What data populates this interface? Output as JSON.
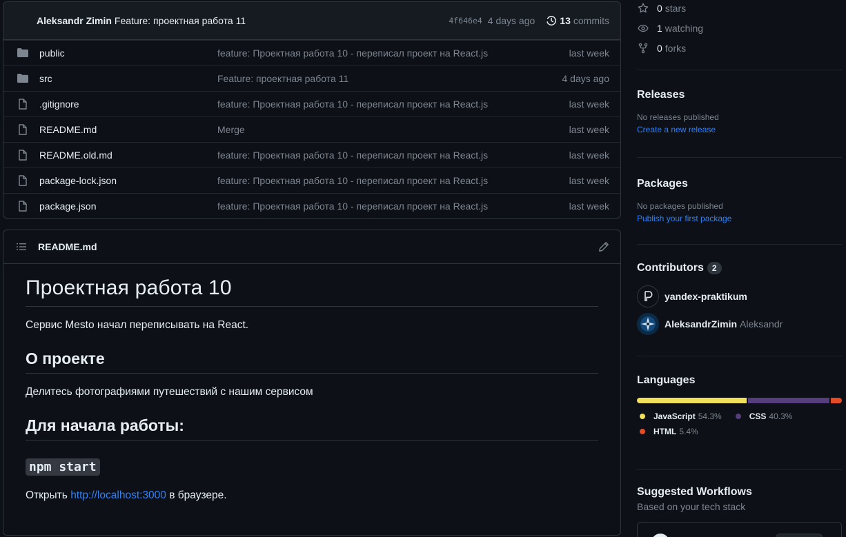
{
  "latest_commit": {
    "author": "Aleksandr Zimin",
    "message": "Feature: проектная работа 11",
    "sha": "4f646e4",
    "when": "4 days ago",
    "commits_count": "13",
    "commits_label": "commits"
  },
  "files": [
    {
      "type": "folder",
      "name": "public",
      "message": "feature: Проектная работа 10 - переписал проект на React.js",
      "when": "last week"
    },
    {
      "type": "folder",
      "name": "src",
      "message": "Feature: проектная работа 11",
      "when": "4 days ago"
    },
    {
      "type": "file",
      "name": ".gitignore",
      "message": "feature: Проектная работа 10 - переписал проект на React.js",
      "when": "last week"
    },
    {
      "type": "file",
      "name": "README.md",
      "message": "Merge",
      "when": "last week"
    },
    {
      "type": "file",
      "name": "README.old.md",
      "message": "feature: Проектная работа 10 - переписал проект на React.js",
      "when": "last week"
    },
    {
      "type": "file",
      "name": "package-lock.json",
      "message": "feature: Проектная работа 10 - переписал проект на React.js",
      "when": "last week"
    },
    {
      "type": "file",
      "name": "package.json",
      "message": "feature: Проектная работа 10 - переписал проект на React.js",
      "when": "last week"
    }
  ],
  "readme": {
    "filename": "README.md",
    "h1": "Проектная работа 10",
    "intro": "Сервис Mesto начал переписывать на React.",
    "h2_about": "О проекте",
    "about_text": "Делитесь фотографиями путешествий с нашим сервисом",
    "h2_start": "Для начала работы:",
    "code": "npm start",
    "open_prefix": "Открыть",
    "open_link": "http://localhost:3000",
    "open_suffix": "в браузере."
  },
  "sidebar": {
    "stars_count": "0",
    "stars_label": "stars",
    "watching_count": "1",
    "watching_label": "watching",
    "forks_count": "0",
    "forks_label": "forks",
    "releases": {
      "title": "Releases",
      "empty": "No releases published",
      "link": "Create a new release"
    },
    "packages": {
      "title": "Packages",
      "empty": "No packages published",
      "link": "Publish your first package"
    },
    "contributors": {
      "title": "Contributors",
      "count": "2",
      "people": [
        {
          "login": "yandex-praktikum",
          "name": ""
        },
        {
          "login": "AleksandrZimin",
          "name": "Aleksandr"
        }
      ]
    },
    "languages": {
      "title": "Languages",
      "items": [
        {
          "name": "JavaScript",
          "pct": "54.3%",
          "value": 54.3,
          "color": "#f1e05a"
        },
        {
          "name": "CSS",
          "pct": "40.3%",
          "value": 40.3,
          "color": "#563d7c"
        },
        {
          "name": "HTML",
          "pct": "5.4%",
          "value": 5.4,
          "color": "#e34c26"
        }
      ]
    },
    "workflows": {
      "title": "Suggested Workflows",
      "subtitle": "Based on your tech stack"
    }
  },
  "colors": {
    "background": "#0d1117",
    "border": "#30363d",
    "muted": "#7d8590",
    "link": "#2f81f7"
  }
}
